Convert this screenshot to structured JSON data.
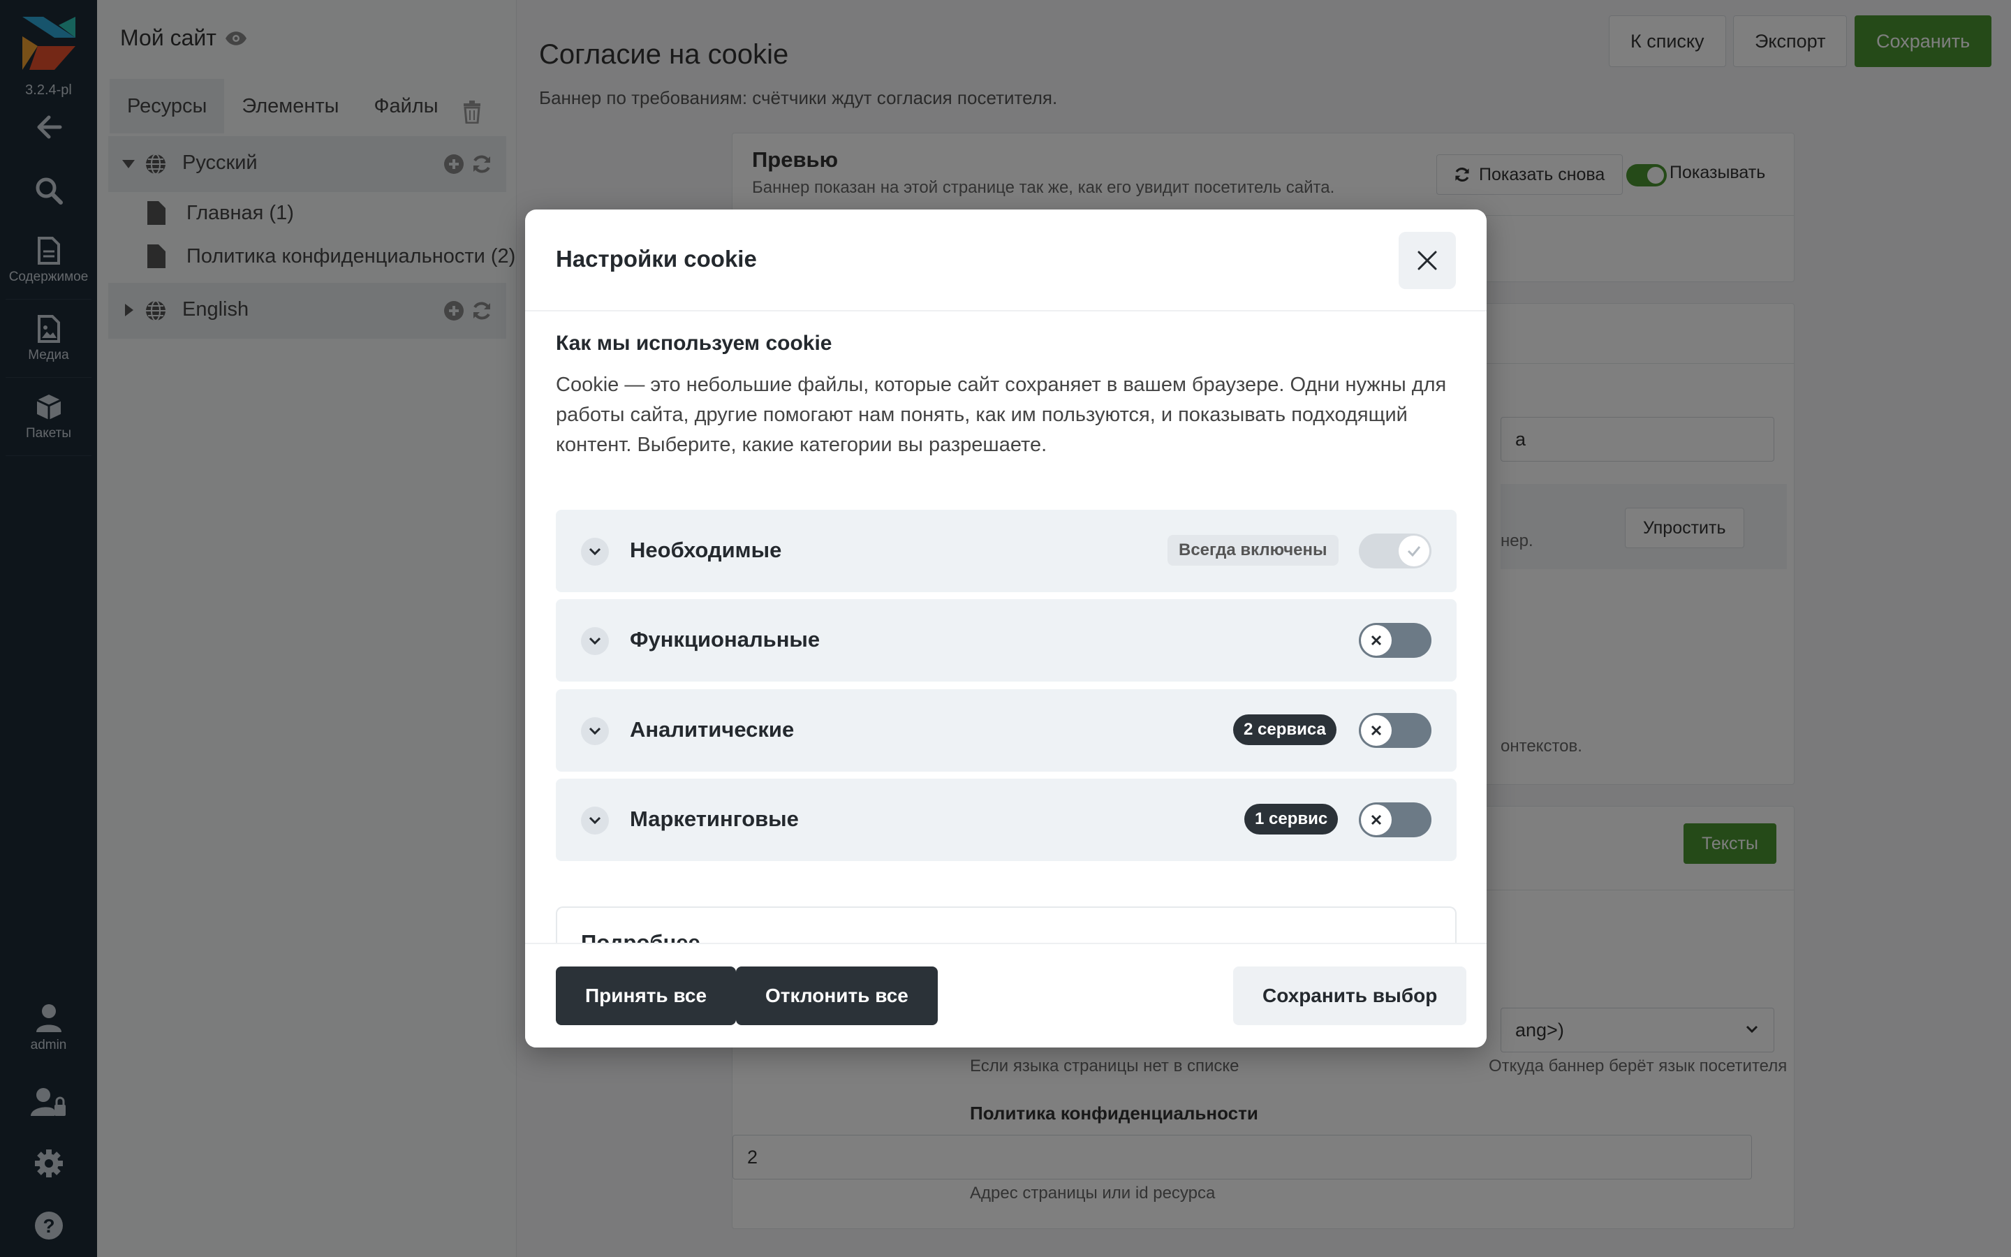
{
  "sidebar": {
    "version": "3.2.4-pl",
    "items": [
      {
        "icon": "arrow-left-icon",
        "label": ""
      },
      {
        "icon": "search-icon",
        "label": ""
      },
      {
        "icon": "file-icon",
        "label": "Содержимое"
      },
      {
        "icon": "file-image-icon",
        "label": "Медиа"
      },
      {
        "icon": "cube-icon",
        "label": "Пакеты"
      }
    ],
    "bottom": [
      {
        "icon": "user-icon",
        "label": "admin"
      },
      {
        "icon": "user-lock-icon",
        "label": ""
      },
      {
        "icon": "gear-icon",
        "label": ""
      },
      {
        "icon": "question-icon",
        "label": ""
      }
    ]
  },
  "tree": {
    "site_name": "Мой сайт",
    "tabs": [
      "Ресурсы",
      "Элементы",
      "Файлы"
    ],
    "contexts": [
      {
        "name": "Русский",
        "expanded": true,
        "children": [
          "Главная (1)",
          "Политика конфиденциальности (2)"
        ]
      },
      {
        "name": "English",
        "expanded": false,
        "children": []
      }
    ]
  },
  "main": {
    "title": "Согласие на cookie",
    "subtitle": "Баннер по требованиям: счётчики ждут согласия посетителя.",
    "buttons": {
      "list": "К списку",
      "export": "Экспорт",
      "save": "Сохранить"
    },
    "preview": {
      "title": "Превью",
      "desc": "Баннер показан на этой странице так же, как его увидит посетитель сайта.",
      "show_again": "Показать снова",
      "show_toggle": "Показывать"
    },
    "partial_field": "а",
    "simplify_btn": "Упростить",
    "partial_text1": "нер.",
    "partial_text2": "онтекстов.",
    "texts_btn": "Тексты",
    "lang_select": "ang>)",
    "help_lang": "Если языка страницы нет в списке",
    "help_source": "Откуда баннер берёт язык посетителя",
    "privacy_label": "Политика конфиденциальности",
    "privacy_value": "2",
    "privacy_help": "Адрес страницы или id ресурса"
  },
  "modal": {
    "title": "Настройки cookie",
    "heading": "Как мы используем cookie",
    "description": "Cookie — это небольшие файлы, которые сайт сохраняет в вашем браузере. Одни нужны для работы сайта, другие помогают нам понять, как им пользуются, и показывать подходящий контент. Выберите, какие категории вы разрешаете.",
    "categories": [
      {
        "name": "Необходимые",
        "badge": "Всегда включены",
        "badge_style": "light",
        "state": "locked-on"
      },
      {
        "name": "Функциональные",
        "badge": "",
        "badge_style": "",
        "state": "off"
      },
      {
        "name": "Аналитические",
        "badge": "2 сервиса",
        "badge_style": "dark",
        "state": "off"
      },
      {
        "name": "Маркетинговые",
        "badge": "1 сервис",
        "badge_style": "dark",
        "state": "off"
      }
    ],
    "more_title": "Подробнее",
    "footer": {
      "accept_all": "Принять все",
      "reject_all": "Отклонить все",
      "save_choice": "Сохранить выбор"
    }
  },
  "colors": {
    "brand_green": "#4b9430",
    "sidebar_bg": "#1d2a36",
    "dark_button": "#2b3238"
  }
}
